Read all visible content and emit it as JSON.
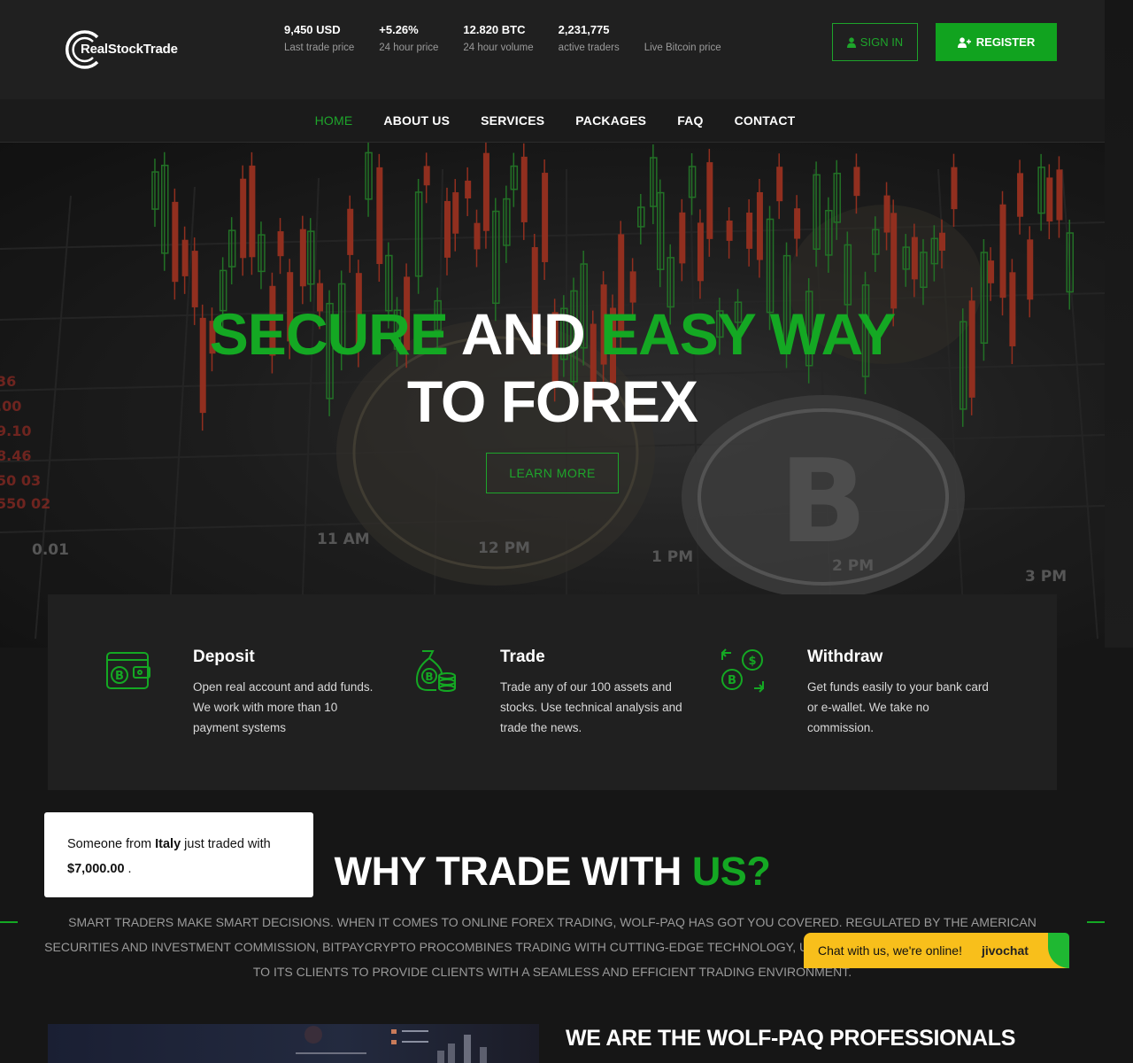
{
  "brand": {
    "name": "RealStockTrade"
  },
  "stats": [
    {
      "value": "9,450 USD",
      "label": "Last trade price"
    },
    {
      "value": "+5.26%",
      "label": "24 hour price"
    },
    {
      "value": "12.820 BTC",
      "label": "24 hour volume"
    },
    {
      "value": "2,231,775",
      "label": "active traders"
    },
    {
      "value": "",
      "label": "Live Bitcoin price"
    }
  ],
  "auth": {
    "signin": "SIGN IN",
    "register": "REGISTER"
  },
  "nav": [
    "HOME",
    "ABOUT US",
    "SERVICES",
    "PACKAGES",
    "FAQ",
    "CONTACT"
  ],
  "hero": {
    "line1_a": "SECURE",
    "line1_b": " AND ",
    "line1_c": "EASY WAY",
    "line2": "TO FOREX",
    "cta": "LEARN MORE",
    "chart_labels": [
      "11 AM",
      "12 PM",
      "1 PM",
      "2 PM",
      "3 PM",
      "0.01"
    ],
    "side_numbers": [
      "36",
      ".00",
      "9.10",
      "8.46",
      "50 03",
      "550 02"
    ]
  },
  "features": [
    {
      "icon": "wallet-bitcoin-icon",
      "title": "Deposit",
      "text": "Open real account and add funds. We work with more than 10 payment systems"
    },
    {
      "icon": "money-bag-bitcoin-icon",
      "title": "Trade",
      "text": "Trade any of our 100 assets and stocks. Use technical analysis and trade the news."
    },
    {
      "icon": "exchange-coins-icon",
      "title": "Withdraw",
      "text": "Get funds easily to your bank card or e-wallet. We take no commission."
    }
  ],
  "toast": {
    "prefix": "Someone from ",
    "country": "Italy",
    "mid": " just traded with",
    "amount": "$7,000.00",
    "suffix": " ."
  },
  "why": {
    "title_a": "WHY TRADE WITH ",
    "title_b": "US?",
    "text": "SMART TRADERS MAKE SMART DECISIONS. WHEN IT COMES TO ONLINE FOREX TRADING, WOLF-PAQ HAS GOT YOU COVERED. REGULATED BY THE AMERICAN SECURITIES AND INVESTMENT COMMISSION, BITPAYCRYPTO PROCOMBINES TRADING WITH CUTTING-EDGE TECHNOLOGY, UNRIVALLED EXPERTISE, AND DEDICATION TO ITS CLIENTS TO PROVIDE CLIENTS WITH A SEAMLESS AND EFFICIENT TRADING ENVIRONMENT."
  },
  "chat": {
    "message": "Chat with us, we're online!",
    "brand": "jivochat"
  },
  "professionals": {
    "title": "WE ARE THE WOLF-PAQ PROFESSIONALS"
  },
  "colors": {
    "accent": "#14a823",
    "background": "#161616",
    "panel": "#202020",
    "chat": "#f8bf1b"
  }
}
